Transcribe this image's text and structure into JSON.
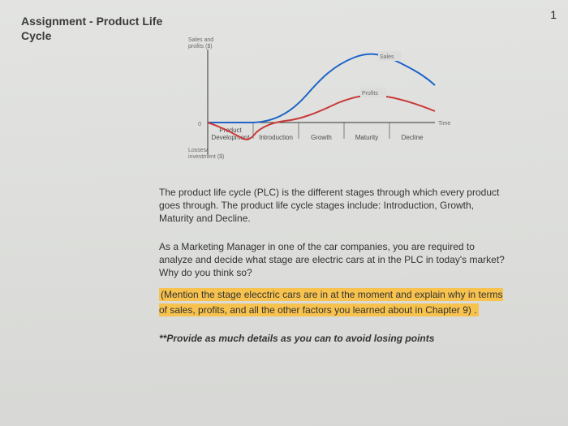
{
  "page_number": "1",
  "title_line1": "Assignment - Product Life",
  "title_line2": "Cycle",
  "chart_data": {
    "type": "line",
    "ylabel_top1": "Sales and",
    "ylabel_top2": "profits ($)",
    "ylabel_bottom1": "Losses/",
    "ylabel_bottom2": "investment ($)",
    "xlabel": "Time",
    "zero_label": "0",
    "phases": [
      "Product Development",
      "Introduction",
      "Growth",
      "Maturity",
      "Decline"
    ],
    "phase_line1": "Product",
    "phase_line2": "Development",
    "series": [
      {
        "name": "Sales",
        "color": "#1e64c8",
        "x": [
          0.0,
          0.2,
          0.3,
          0.4,
          0.5,
          0.58,
          0.66,
          0.74,
          0.82,
          0.9,
          1.0
        ],
        "y": [
          0,
          0,
          3,
          12,
          36,
          62,
          82,
          90,
          88,
          80,
          62
        ]
      },
      {
        "name": "Profits",
        "color": "#c93a3a",
        "x": [
          0.0,
          0.1,
          0.16,
          0.2,
          0.26,
          0.34,
          0.44,
          0.56,
          0.68,
          0.78,
          0.88,
          1.0
        ],
        "y": [
          0,
          -6,
          -12,
          -16,
          -8,
          0,
          10,
          22,
          31,
          32,
          28,
          18
        ]
      }
    ],
    "sales_label": "Sales",
    "profits_label": "Profits",
    "ylim": [
      -20,
      100
    ]
  },
  "para1": "The product life cycle (PLC) is the different stages through which every product goes through. The product life cycle stages include: Introduction, Growth, Maturity and Decline.",
  "para2": "As a Marketing Manager in one of the car companies, you are required to analyze and decide what stage are electric cars at in the PLC in today's market? Why do you think so?",
  "highlight_text": "(Mention the stage elecctric cars are in at the moment and explain why in terms of sales, profits, and all the other factors you learned about in Chapter 9) .",
  "note_text": "**Provide as much details as you can to avoid losing points"
}
